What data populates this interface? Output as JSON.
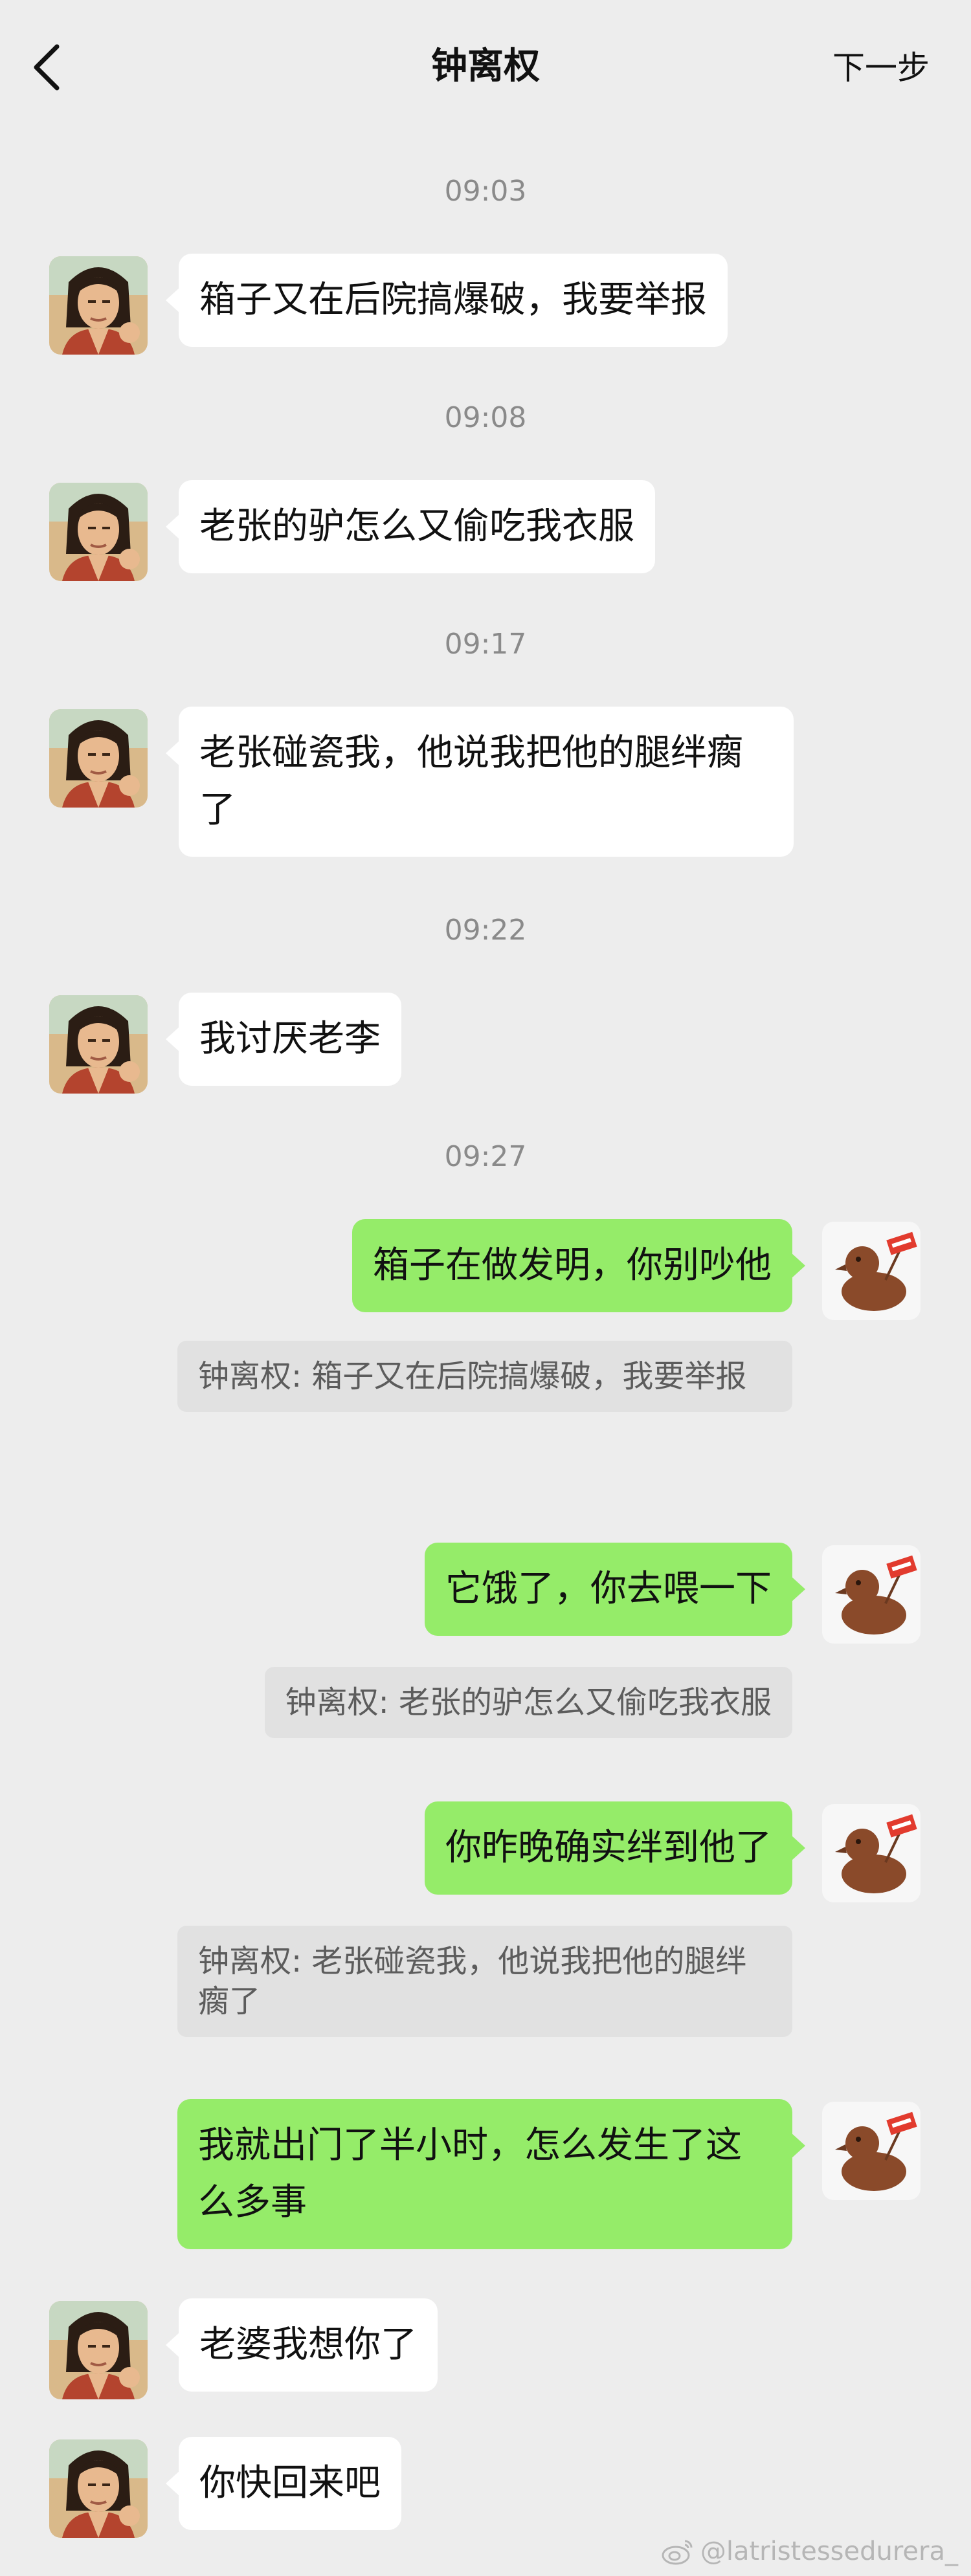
{
  "header": {
    "title": "钟离权",
    "next_label": "下一步",
    "back_icon": "chevron-left-icon"
  },
  "messages": [
    {
      "type": "time",
      "text": "09:03"
    },
    {
      "type": "in",
      "text": "箱子又在后院搞爆破，我要举报"
    },
    {
      "type": "time",
      "text": "09:08"
    },
    {
      "type": "in",
      "text": "老张的驴怎么又偷吃我衣服"
    },
    {
      "type": "time",
      "text": "09:17"
    },
    {
      "type": "in",
      "text": "老张碰瓷我，他说我把他的腿绊瘸了"
    },
    {
      "type": "time",
      "text": "09:22"
    },
    {
      "type": "in",
      "text": "我讨厌老李"
    },
    {
      "type": "time",
      "text": "09:27"
    },
    {
      "type": "out",
      "text": "箱子在做发明，你别吵他"
    },
    {
      "type": "quote",
      "text": "钟离权: 箱子又在后院搞爆破，我要举报"
    },
    {
      "type": "out",
      "text": "它饿了，你去喂一下"
    },
    {
      "type": "quote",
      "text": "钟离权: 老张的驴怎么又偷吃我衣服"
    },
    {
      "type": "out",
      "text": "你昨晚确实绊到他了"
    },
    {
      "type": "quote",
      "text": "钟离权: 老张碰瓷我，他说我把他的腿绊瘸了"
    },
    {
      "type": "out",
      "text": "我就出门了半小时，怎么发生了这么多事"
    },
    {
      "type": "in",
      "text": "老婆我想你了"
    },
    {
      "type": "in",
      "text": "你快回来吧"
    }
  ],
  "watermark": {
    "text": "@latristessedurera_",
    "icon": "weibo-icon"
  },
  "colors": {
    "background": "#ededed",
    "incoming": "#ffffff",
    "outgoing": "#95ec69",
    "quote": "#e1e1e1"
  }
}
